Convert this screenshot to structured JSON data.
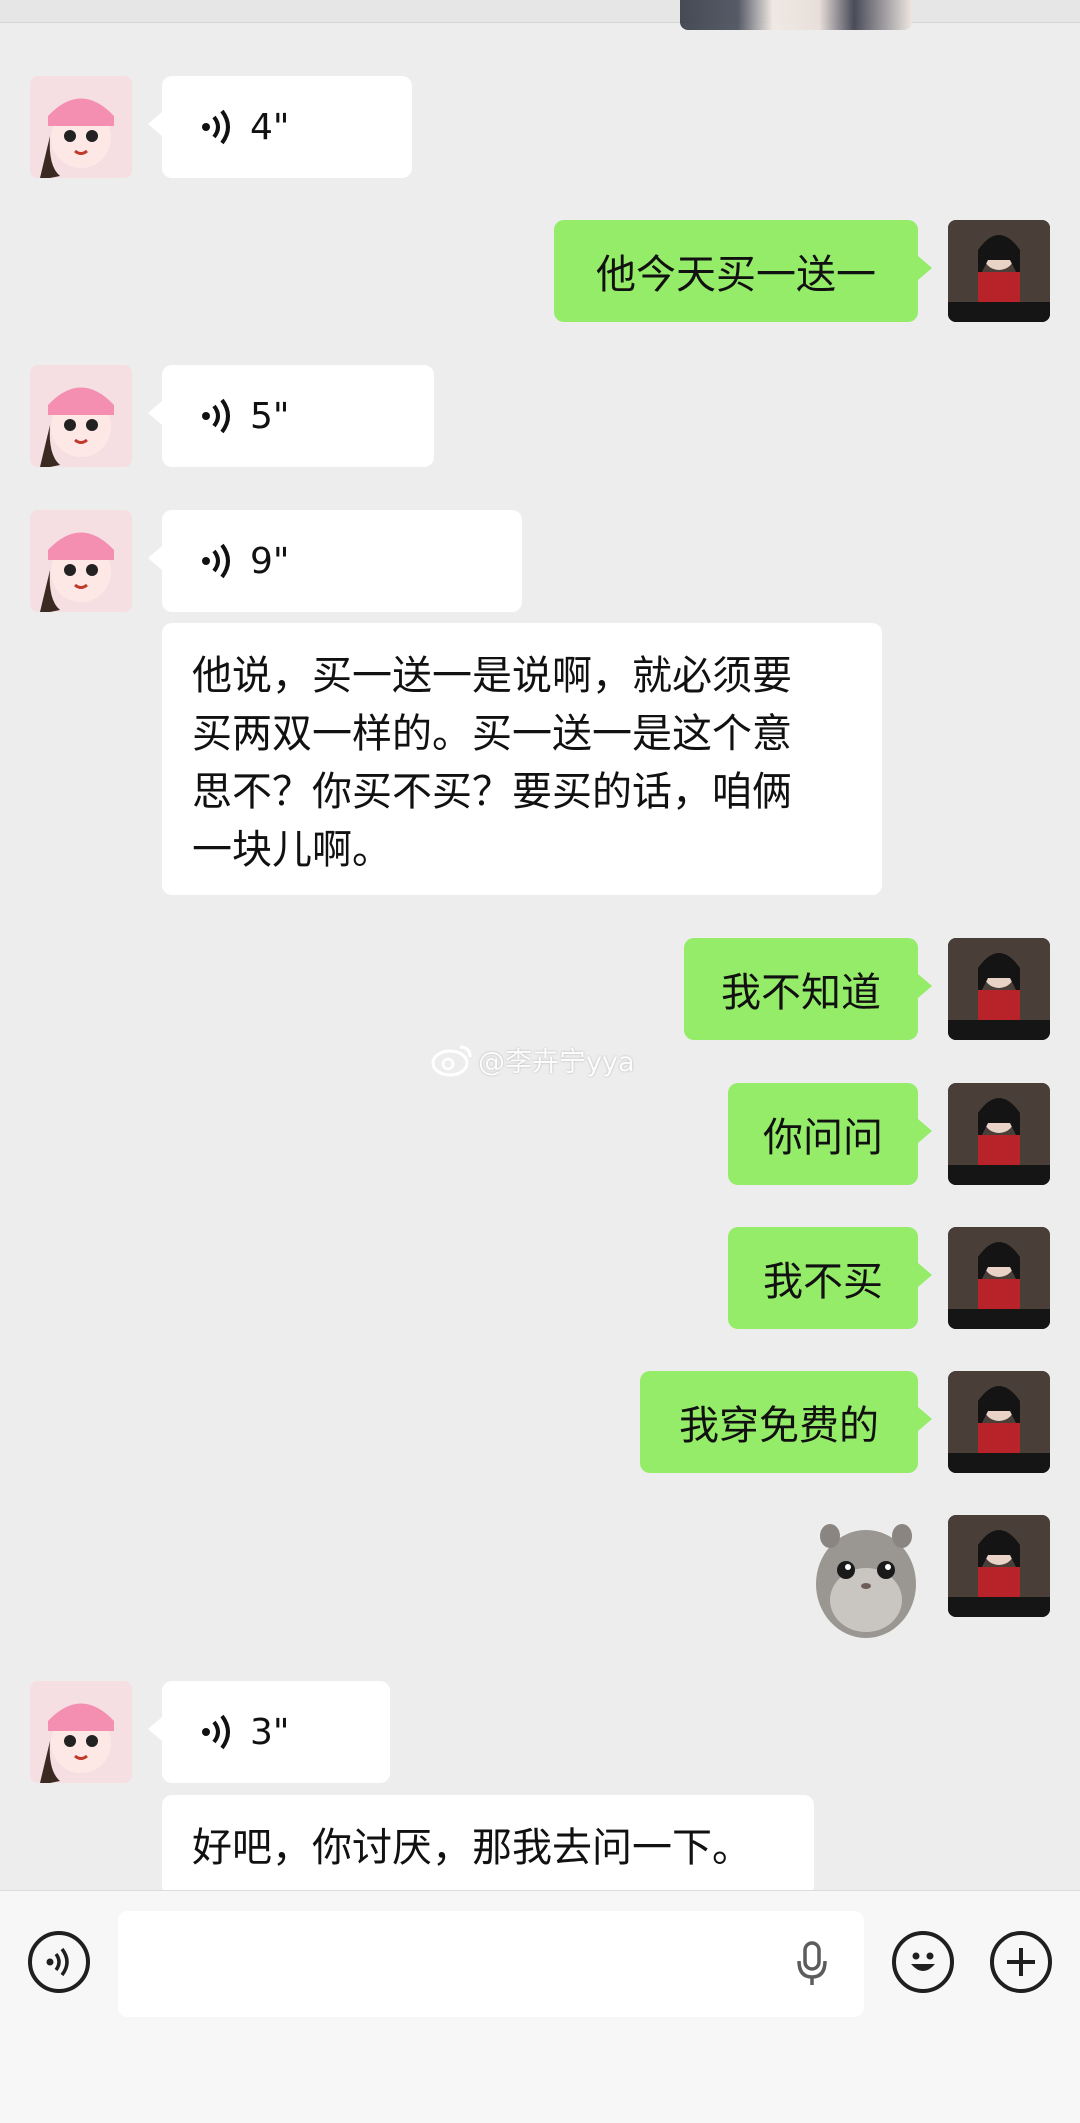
{
  "messages": [
    {
      "side": "left",
      "type": "voice",
      "duration": "4\""
    },
    {
      "side": "right",
      "type": "text",
      "text": "他今天买一送一"
    },
    {
      "side": "left",
      "type": "voice",
      "duration": "5\""
    },
    {
      "side": "left",
      "type": "voice",
      "duration": "9\""
    },
    {
      "side": "left",
      "type": "transcript",
      "lines": [
        "他说，买一送一是说啊，就必须要",
        "买两双一样的。买一送一是这个意",
        "思不？你买不买？要买的话，咱俩",
        "一块儿啊。"
      ]
    },
    {
      "side": "right",
      "type": "text",
      "text": "我不知道"
    },
    {
      "side": "right",
      "type": "text",
      "text": "你问问"
    },
    {
      "side": "right",
      "type": "text",
      "text": "我不买"
    },
    {
      "side": "right",
      "type": "text",
      "text": "我穿免费的"
    },
    {
      "side": "right",
      "type": "sticker",
      "icon": "hamster-sticker"
    },
    {
      "side": "left",
      "type": "voice",
      "duration": "3\""
    },
    {
      "side": "left",
      "type": "transcript",
      "lines": [
        "好吧，你讨厌，那我去问一下。"
      ]
    }
  ],
  "watermark": "@李卉宁yya",
  "input_bar": {
    "voice_icon": "voice-toggle-icon",
    "mic_icon": "microphone-icon",
    "emoji_icon": "emoji-icon",
    "plus_icon": "plus-icon",
    "value": ""
  },
  "colors": {
    "background": "#ededed",
    "self_bubble": "#95ec69",
    "other_bubble": "#ffffff"
  }
}
